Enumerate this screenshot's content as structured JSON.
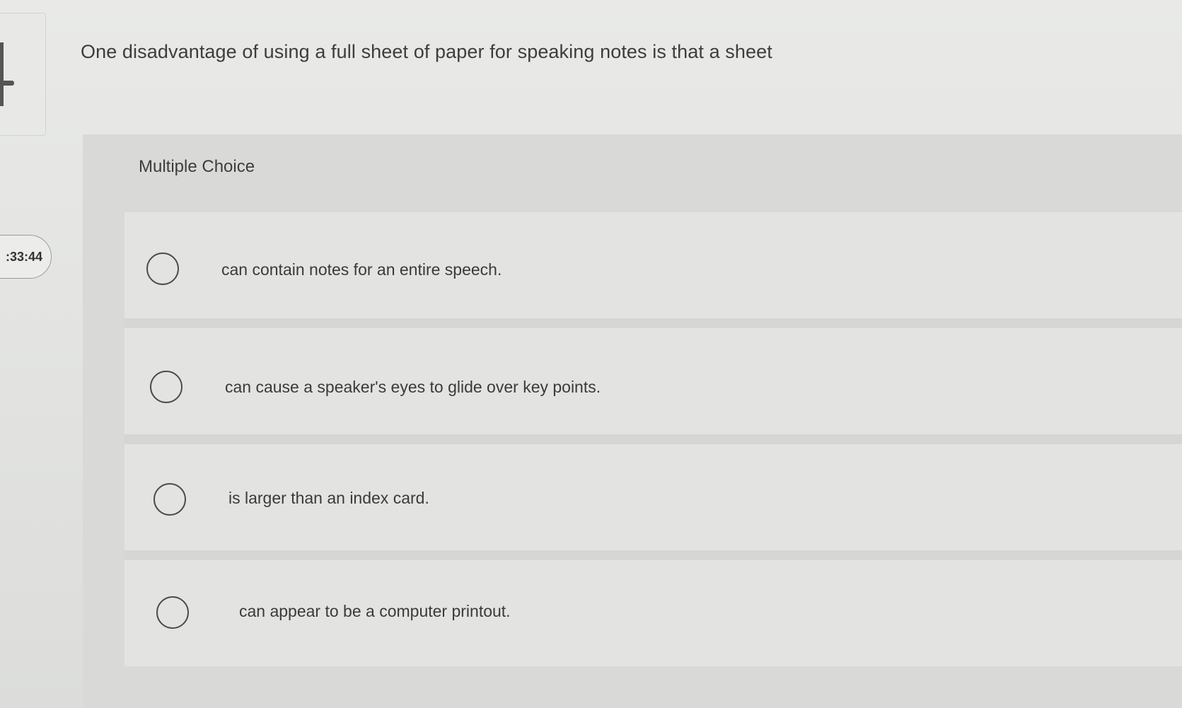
{
  "question": {
    "text": "One disadvantage of using a full sheet of paper for speaking notes is that a sheet"
  },
  "question_type": "Multiple Choice",
  "timer": {
    "value": ":33:44"
  },
  "options": [
    {
      "label": "can contain notes for an entire speech.",
      "selected": false
    },
    {
      "label": "can cause a speaker's eyes to glide over key points.",
      "selected": false
    },
    {
      "label": "is larger than an index card.",
      "selected": false
    },
    {
      "label": "can appear to be a computer printout.",
      "selected": false
    }
  ],
  "icons": {
    "radio": "radio-button-icon"
  },
  "colors": {
    "background": "#e4e5e3",
    "panel": "#d9dad8",
    "text": "#3a3a3a",
    "radio_border": "#4c4c4c"
  }
}
